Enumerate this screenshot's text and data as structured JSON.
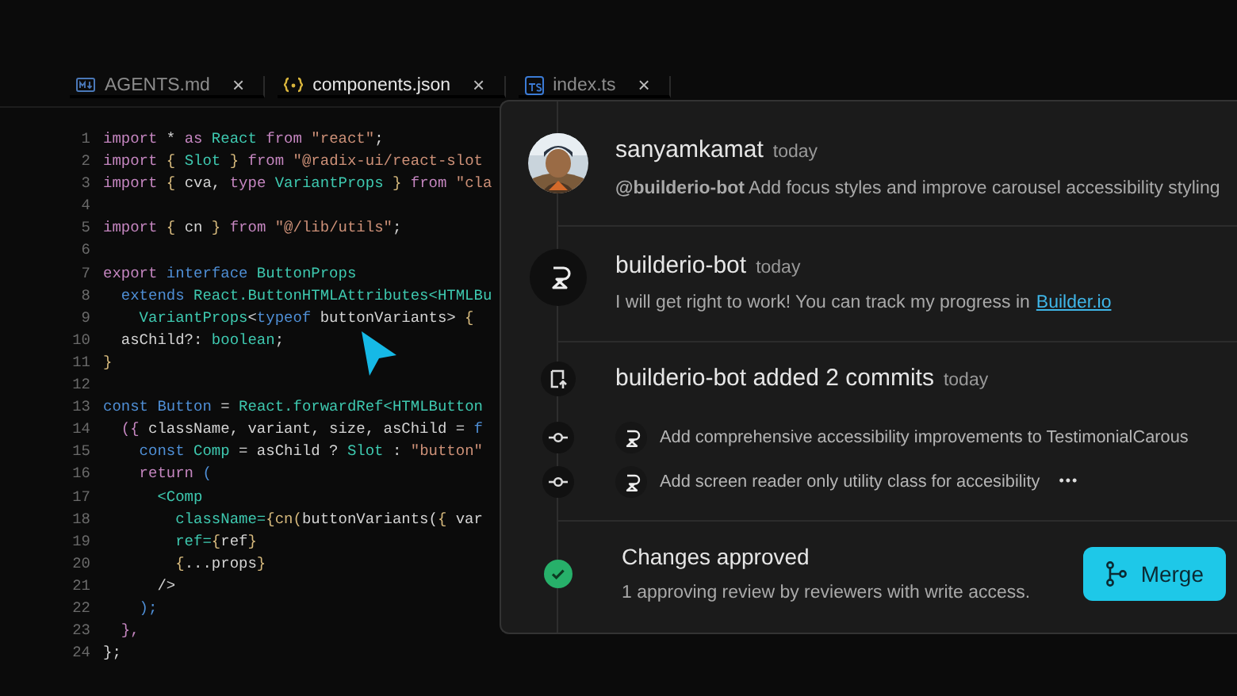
{
  "tabs": [
    {
      "label": "AGENTS.md",
      "kind": "md",
      "selected": false,
      "close": "×"
    },
    {
      "label": "components.json",
      "kind": "json",
      "selected": true,
      "close": "×"
    },
    {
      "label": "index.ts",
      "kind": "ts",
      "selected": false,
      "close": "×"
    }
  ],
  "code": {
    "lines": [
      {
        "number": "1",
        "tokens": [
          {
            "text": "import",
            "kind": "kw"
          },
          {
            "text": " * ",
            "kind": "plain"
          },
          {
            "text": "as",
            "kind": "kw"
          },
          {
            "text": " React",
            "kind": "type"
          },
          {
            "text": " from",
            "kind": "kw"
          },
          {
            "text": " \"react\"",
            "kind": "str"
          },
          {
            "text": ";",
            "kind": "plain"
          }
        ]
      },
      {
        "number": "2",
        "tokens": [
          {
            "text": "import",
            "kind": "kw"
          },
          {
            "text": " {",
            "kind": "punct"
          },
          {
            "text": " Slot",
            "kind": "type"
          },
          {
            "text": " }",
            "kind": "punct"
          },
          {
            "text": " from",
            "kind": "kw"
          },
          {
            "text": " \"@radix-ui/react-slot",
            "kind": "str"
          }
        ]
      },
      {
        "number": "3",
        "tokens": [
          {
            "text": "import",
            "kind": "kw"
          },
          {
            "text": " {",
            "kind": "punct"
          },
          {
            "text": " cva,",
            "kind": "plain"
          },
          {
            "text": " type",
            "kind": "kw"
          },
          {
            "text": " VariantProps",
            "kind": "type"
          },
          {
            "text": " }",
            "kind": "punct"
          },
          {
            "text": " from",
            "kind": "kw"
          },
          {
            "text": " \"cla",
            "kind": "str"
          }
        ]
      },
      {
        "number": "4"
      },
      {
        "number": "5",
        "tokens": [
          {
            "text": "import",
            "kind": "kw"
          },
          {
            "text": " {",
            "kind": "punct"
          },
          {
            "text": " cn",
            "kind": "plain"
          },
          {
            "text": " }",
            "kind": "punct"
          },
          {
            "text": " from",
            "kind": "kw"
          },
          {
            "text": " \"@/lib/utils\"",
            "kind": "str"
          },
          {
            "text": ";",
            "kind": "plain"
          }
        ]
      },
      {
        "number": "6"
      },
      {
        "number": "7",
        "tokens": [
          {
            "text": "export",
            "kind": "kw"
          },
          {
            "text": " interface",
            "kind": "decl"
          },
          {
            "text": " ButtonProps",
            "kind": "type"
          }
        ]
      },
      {
        "number": "8",
        "tokens": [
          {
            "text": "  extends",
            "kind": "decl"
          },
          {
            "text": " React.ButtonHTMLAttributes<HTMLBu",
            "kind": "type"
          }
        ]
      },
      {
        "number": "9",
        "tokens": [
          {
            "text": "    VariantProps",
            "kind": "type"
          },
          {
            "text": "<",
            "kind": "plain"
          },
          {
            "text": "typeof",
            "kind": "decl"
          },
          {
            "text": " buttonVariants>",
            "kind": "plain"
          },
          {
            "text": " {",
            "kind": "punct"
          }
        ]
      },
      {
        "number": "10",
        "tokens": [
          {
            "text": "  asChild?:",
            "kind": "plain"
          },
          {
            "text": " boolean",
            "kind": "type"
          },
          {
            "text": ";",
            "kind": "plain"
          }
        ]
      },
      {
        "number": "11",
        "tokens": [
          {
            "text": "}",
            "kind": "punct"
          }
        ]
      },
      {
        "number": "12"
      },
      {
        "number": "13",
        "tokens": [
          {
            "text": "const",
            "kind": "decl"
          },
          {
            "text": " Button",
            "kind": "decl"
          },
          {
            "text": " =",
            "kind": "plain"
          },
          {
            "text": " React.forwardRef<HTMLButton",
            "kind": "type"
          }
        ]
      },
      {
        "number": "14",
        "tokens": [
          {
            "text": "  ({",
            "kind": "kw"
          },
          {
            "text": " className, variant, size, asChild =",
            "kind": "plain"
          },
          {
            "text": " f",
            "kind": "decl"
          }
        ]
      },
      {
        "number": "15",
        "tokens": [
          {
            "text": "    const",
            "kind": "decl"
          },
          {
            "text": " Comp",
            "kind": "type"
          },
          {
            "text": " = asChild ?",
            "kind": "plain"
          },
          {
            "text": " Slot",
            "kind": "type"
          },
          {
            "text": " :",
            "kind": "plain"
          },
          {
            "text": " \"button\"",
            "kind": "str"
          }
        ]
      },
      {
        "number": "16",
        "tokens": [
          {
            "text": "    return",
            "kind": "kw"
          },
          {
            "text": " (",
            "kind": "decl"
          }
        ]
      },
      {
        "number": "17",
        "tokens": [
          {
            "text": "      <Comp",
            "kind": "type"
          }
        ]
      },
      {
        "number": "18",
        "tokens": [
          {
            "text": "        className=",
            "kind": "type"
          },
          {
            "text": "{cn(",
            "kind": "punct"
          },
          {
            "text": "buttonVariants(",
            "kind": "plain"
          },
          {
            "text": "{",
            "kind": "punct"
          },
          {
            "text": " var",
            "kind": "plain"
          }
        ]
      },
      {
        "number": "19",
        "tokens": [
          {
            "text": "        ref=",
            "kind": "type"
          },
          {
            "text": "{",
            "kind": "punct"
          },
          {
            "text": "ref",
            "kind": "plain"
          },
          {
            "text": "}",
            "kind": "punct"
          }
        ]
      },
      {
        "number": "20",
        "tokens": [
          {
            "text": "        {",
            "kind": "punct"
          },
          {
            "text": "...props",
            "kind": "plain"
          },
          {
            "text": "}",
            "kind": "punct"
          }
        ]
      },
      {
        "number": "21",
        "tokens": [
          {
            "text": "      />",
            "kind": "plain"
          }
        ]
      },
      {
        "number": "22",
        "tokens": [
          {
            "text": "    );",
            "kind": "decl"
          }
        ]
      },
      {
        "number": "23",
        "tokens": [
          {
            "text": "  },",
            "kind": "kw"
          }
        ]
      },
      {
        "number": "24",
        "tokens": [
          {
            "text": "};",
            "kind": "plain"
          }
        ]
      }
    ]
  },
  "timeline": [
    {
      "kind": "comment",
      "author": "sanyamkamat",
      "time": "today",
      "text": "**@builderio-bot** Add focus styles and improve carousel accessibility styling"
    },
    {
      "kind": "bot_comment",
      "author": "builderio-bot",
      "time": "today",
      "text": "I will get right to work! You can track my progress in",
      "link": "Builder.io"
    },
    {
      "kind": "commits",
      "title": "builderio-bot added 2 commits",
      "time": "today",
      "commits": [
        {
          "message": "Add comprehensive accessibility improvements to TestimonialCarous"
        },
        {
          "message": "Add screen reader only utility class for accesibility",
          "more": "•••"
        }
      ]
    },
    {
      "kind": "approval",
      "title": "Changes approved",
      "text": "1 approving review by reviewers with write access.",
      "button": "Merge"
    }
  ]
}
